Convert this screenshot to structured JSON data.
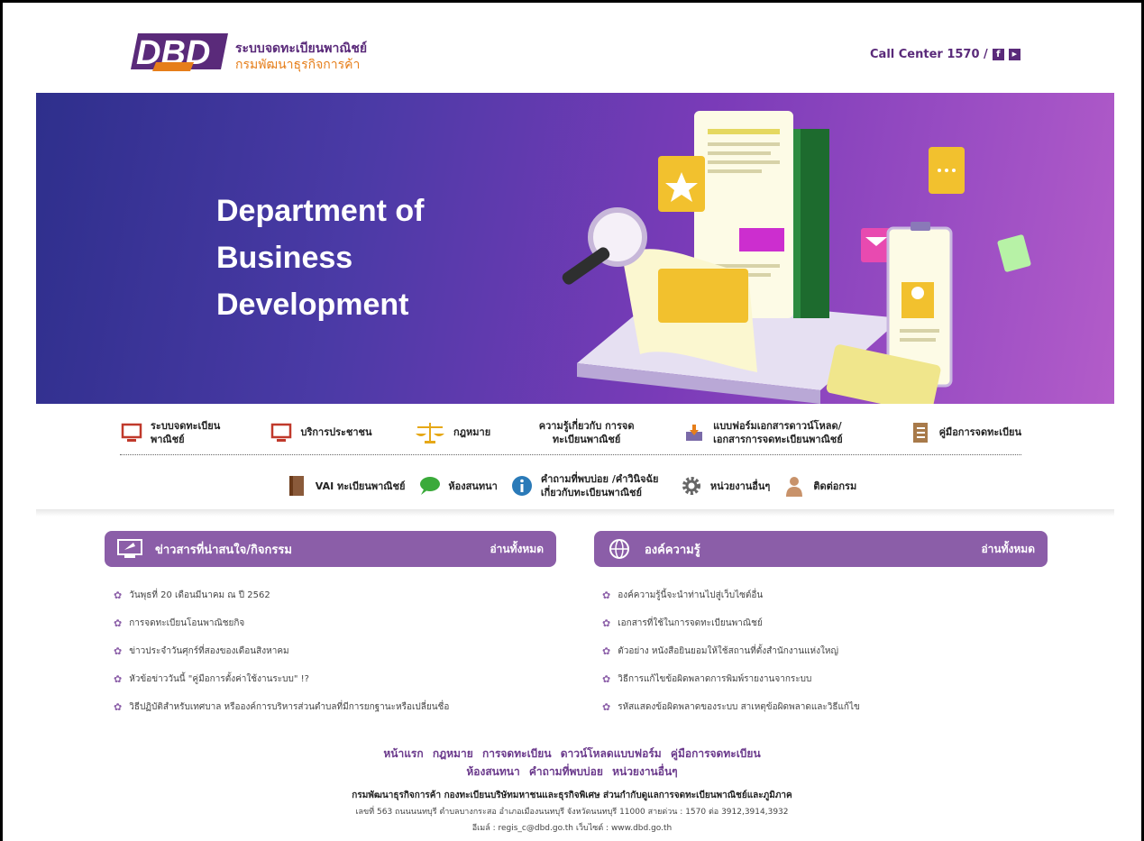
{
  "header": {
    "logo_text": "DBD",
    "brand_line1": "ระบบจดทะเบียนพาณิชย์",
    "brand_line2": "กรมพัฒนาธุรกิจการค้า",
    "call_center": "Call Center 1570 /",
    "facebook_icon": "f",
    "youtube_icon": "▶"
  },
  "hero": {
    "title": "Department of Business Development"
  },
  "menu": {
    "row1": [
      {
        "label": "ระบบจดทะเบียน พาณิชย์",
        "icon": "monitor-icon"
      },
      {
        "label": "บริการประชาชน",
        "icon": "monitor-icon"
      },
      {
        "label": "กฎหมาย",
        "icon": "scales-icon"
      },
      {
        "label": "ความรู้เกี่ยวกับ การจดทะเบียนพาณิชย์",
        "icon": "none"
      },
      {
        "label": "แบบฟอร์มเอกสารดาวน์โหลด/ เอกสารการจดทะเบียนพาณิชย์",
        "icon": "download-icon"
      },
      {
        "label": "คู่มือการจดทะเบียน",
        "icon": "book-icon"
      }
    ],
    "row2": [
      {
        "label": "VAI ทะเบียนพาณิชย์",
        "icon": "book-icon"
      },
      {
        "label": "ห้องสนทนา",
        "icon": "chat-icon"
      },
      {
        "label": "คำถามที่พบบ่อย /คำวินิจฉัย เกี่ยวกับทะเบียนพาณิชย์",
        "icon": "info-icon"
      },
      {
        "label": "หน่วยงานอื่นๆ",
        "icon": "gear-icon"
      },
      {
        "label": "ติดต่อกรม",
        "icon": "person-icon"
      }
    ]
  },
  "news": {
    "title": "ข่าวสารที่น่าสนใจ/กิจกรรม",
    "read_all": "อ่านทั้งหมด",
    "items": [
      "วันพุธที่ 20 เดือนมีนาคม ณ ปี 2562",
      "การจดทะเบียนโอนพาณิชยกิจ",
      "ข่าวประจำวันศุกร์ที่สองของเดือนสิงหาคม",
      "หัวข้อข่าววันนี้ \"คู่มือการตั้งค่าใช้งานระบบ\" !?",
      "วิธีปฏิบัติสำหรับเทศบาล หรือองค์การบริหารส่วนตำบลที่มีการยกฐานะหรือเปลี่ยนชื่อ"
    ]
  },
  "knowledge": {
    "title": "องค์ความรู้",
    "read_all": "อ่านทั้งหมด",
    "items": [
      "องค์ความรู้นี้จะนำท่านไปสู่เว็บไซต์อื่น",
      "เอกสารที่ใช้ในการจดทะเบียนพาณิชย์",
      "ตัวอย่าง หนังสือยินยอมให้ใช้สถานที่ตั้งสำนักงานแห่งใหญ่",
      "วิธีการแก้ไขข้อผิดพลาดการพิมพ์รายงานจากระบบ",
      "รหัสแสดงข้อผิดพลาดของระบบ สาเหตุข้อผิดพลาดและวิธีแก้ไข"
    ]
  },
  "footer": {
    "links1": [
      "หน้าแรก",
      "กฎหมาย",
      "การจดทะเบียน",
      "ดาวน์โหลดแบบฟอร์ม",
      "คู่มือการจดทะเบียน"
    ],
    "links2": [
      "ห้องสนทนา",
      "คำถามที่พบบ่อย",
      "หน่วยงานอื่นๆ"
    ],
    "org": "กรมพัฒนาธุรกิจการค้า กองทะเบียนบริษัทมหาชนและธุรกิจพิเศษ ส่วนกำกับดูแลการจดทะเบียนพาณิชย์และภูมิภาค",
    "address": "เลขที่ 563 ถนนนนทบุรี ตำบลบางกระสอ อำเภอเมืองนนทบุรี จังหวัดนนทบุรี 11000 สายด่วน : 1570 ต่อ 3912,3914,3932",
    "email": "อีเมล์ : regis_c@dbd.go.th เว็บไซต์ : www.dbd.go.th"
  },
  "colors": {
    "brand_purple": "#5a2a7a",
    "brand_orange": "#e67e1a",
    "panel_purple": "#8b5ea8"
  }
}
